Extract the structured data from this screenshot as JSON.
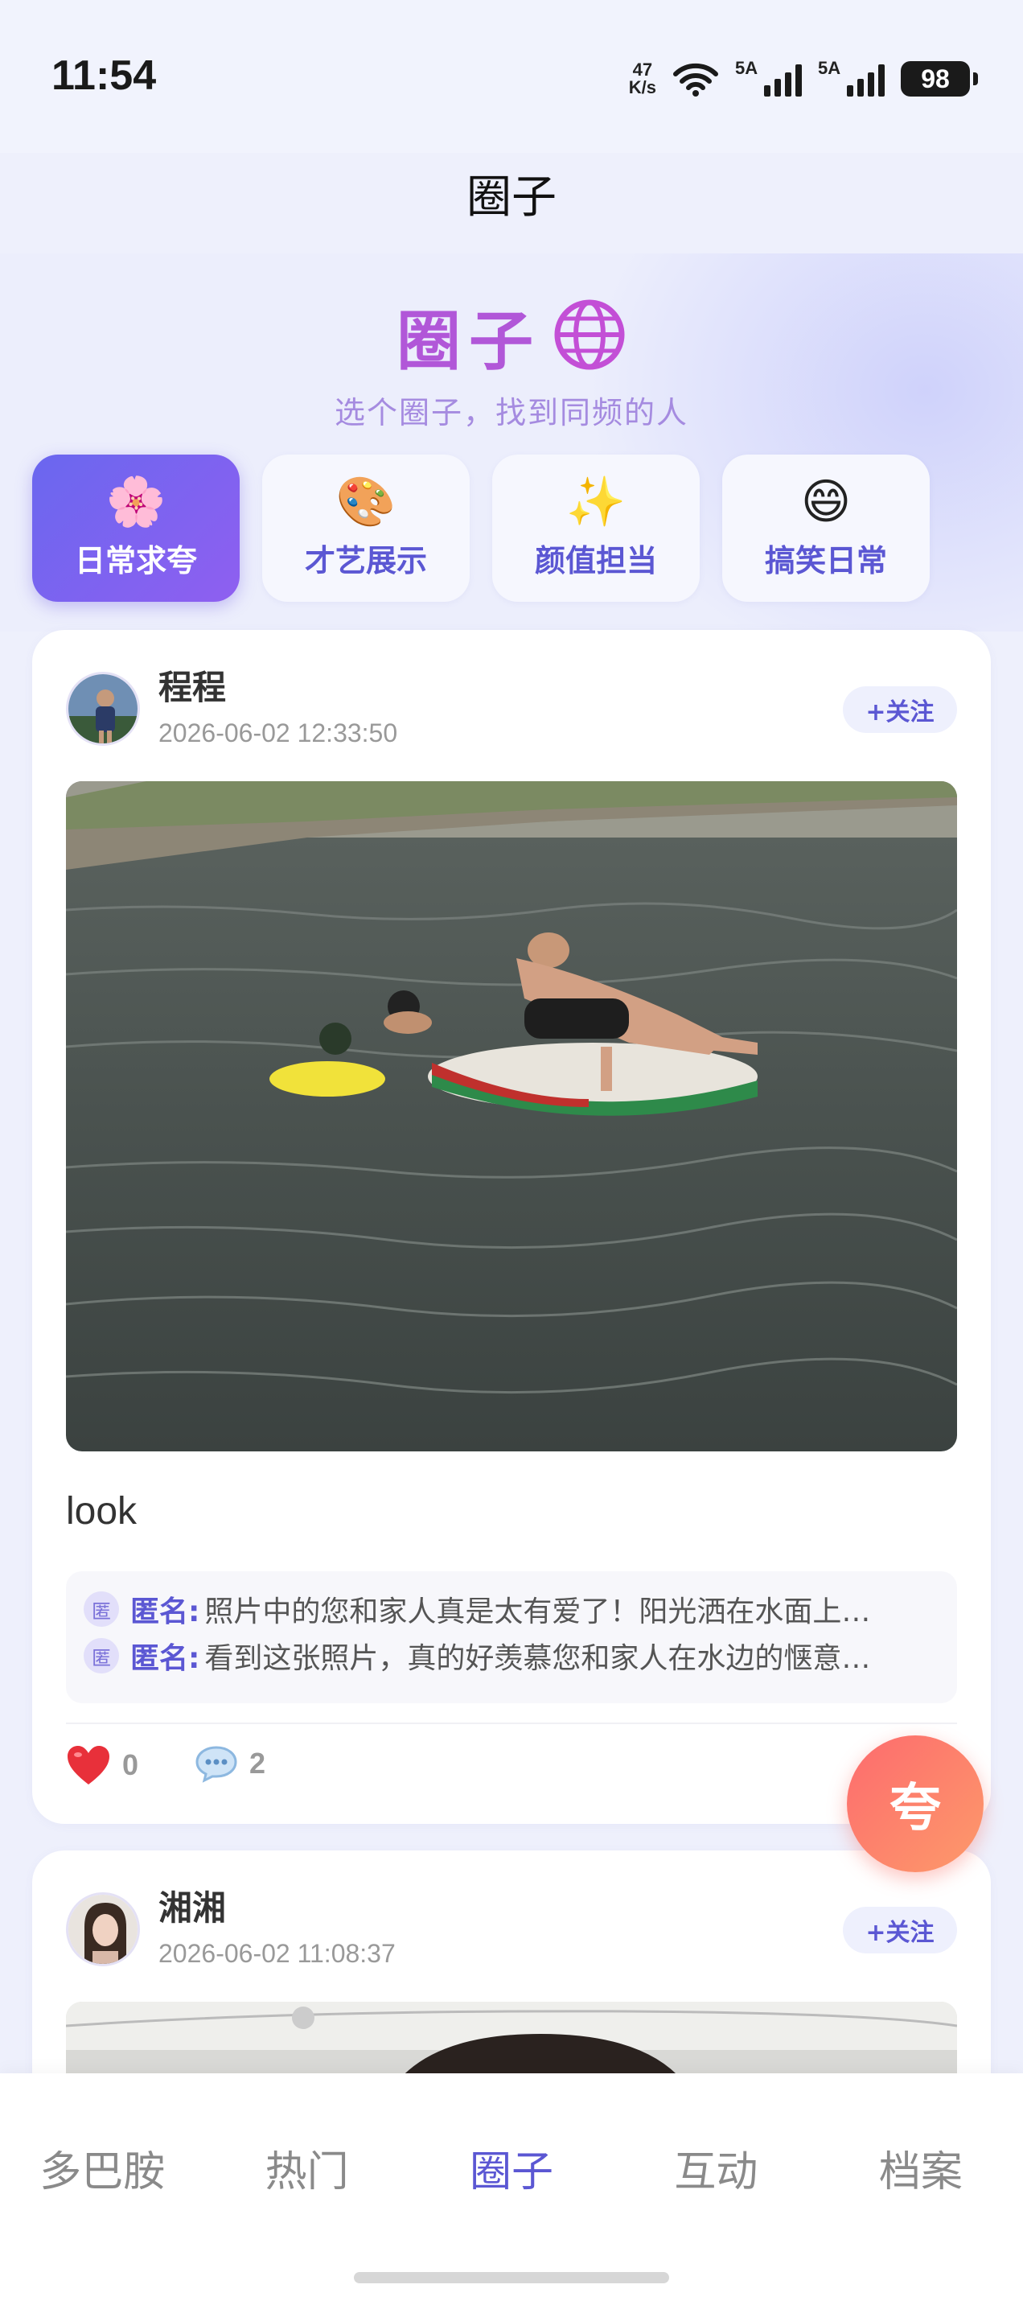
{
  "status_bar": {
    "time": "11:54",
    "net_speed_value": "47",
    "net_speed_unit": "K/s",
    "sim1_label": "5A",
    "sim2_label": "5A",
    "battery": "98"
  },
  "header": {
    "title": "圈子"
  },
  "hero": {
    "title": "圈子",
    "subtitle": "选个圈子，找到同频的人"
  },
  "categories": [
    {
      "emoji": "🌸",
      "label": "日常求夸",
      "active": true
    },
    {
      "emoji": "🎨",
      "label": "才艺展示",
      "active": false
    },
    {
      "emoji": "✨",
      "label": "颜值担当",
      "active": false
    },
    {
      "emoji": "😄",
      "label": "搞笑日常",
      "active": false
    }
  ],
  "posts": [
    {
      "user": "程程",
      "time": "2026-06-02 12:33:50",
      "follow_label": "+关注",
      "caption": "look",
      "comments": [
        {
          "badge": "匿",
          "name": "匿名:",
          "text": "照片中的您和家人真是太有爱了！阳光洒在水面上…"
        },
        {
          "badge": "匿",
          "name": "匿名:",
          "text": "看到这张照片，真的好羡慕您和家人在水边的惬意…"
        }
      ],
      "likes": "0",
      "comment_count": "2"
    },
    {
      "user": "湘湘",
      "time": "2026-06-02 11:08:37",
      "follow_label": "+关注"
    }
  ],
  "fab_label": "夸",
  "tabbar": {
    "items": [
      {
        "label": "多巴胺",
        "active": false
      },
      {
        "label": "热门",
        "active": false
      },
      {
        "label": "圈子",
        "active": true
      },
      {
        "label": "互动",
        "active": false
      },
      {
        "label": "档案",
        "active": false
      }
    ]
  },
  "colors": {
    "accent": "#5b57d3",
    "hero_title": "#b157d8",
    "fab": "#fd7a6c",
    "like_heart": "#e8303a"
  },
  "icons": {
    "globe": "globe-icon",
    "heart": "heart-icon",
    "comment": "comment-bubble-icon",
    "wifi": "wifi-icon"
  }
}
